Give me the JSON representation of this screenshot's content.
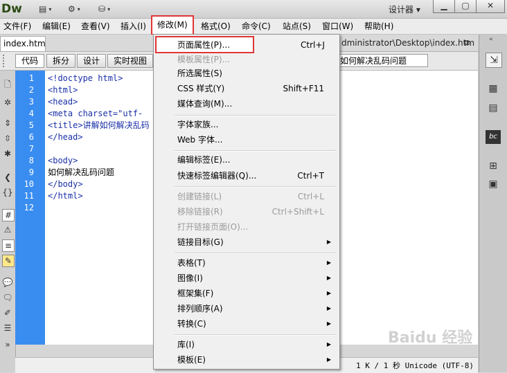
{
  "app": {
    "logo": "Dw",
    "workspace": "设计器 ▾"
  },
  "window_buttons": {
    "minimize": "▁",
    "maximize": "▢",
    "close": "✕"
  },
  "toolbar_icons": [
    "layout-icon",
    "gear-icon",
    "site-icon"
  ],
  "menubar": {
    "items": [
      "文件(F)",
      "编辑(E)",
      "查看(V)",
      "插入(I)",
      "修改(M)",
      "格式(O)",
      "命令(C)",
      "站点(S)",
      "窗口(W)",
      "帮助(H)"
    ]
  },
  "document": {
    "tab_name": "index.htm",
    "file_path": "dministrator\\Desktop\\index.htm",
    "title_field": "如何解决乱码问题"
  },
  "view_buttons": [
    "代码",
    "拆分",
    "设计",
    "实时视图"
  ],
  "code": {
    "line_numbers": [
      "1",
      "2",
      "3",
      "4",
      "5",
      "6",
      "7",
      "8",
      "9",
      "10",
      "11",
      "12"
    ],
    "lines": [
      "<!doctype html>",
      "<html>",
      "<head>",
      "<meta charset=\"utf-",
      "<title>讲解如何解决乱码",
      "</head>",
      "",
      "<body>",
      "如何解决乱码问题",
      "</body>",
      "</html>",
      ""
    ]
  },
  "status": {
    "text": "1 K / 1 秒 Unicode (UTF-8)"
  },
  "dropdown": {
    "items": [
      {
        "label": "页面属性(P)...",
        "shortcut": "Ctrl+J"
      },
      {
        "label": "模板属性(P)...",
        "shortcut": ""
      },
      {
        "label": "所选属性(S)",
        "shortcut": ""
      },
      {
        "label": "CSS 样式(Y)",
        "shortcut": "Shift+F11"
      },
      {
        "label": "媒体查询(M)...",
        "shortcut": ""
      },
      {
        "label": "字体家族...",
        "shortcut": ""
      },
      {
        "label": "Web 字体...",
        "shortcut": ""
      },
      {
        "label": "编辑标签(E)...",
        "shortcut": ""
      },
      {
        "label": "快速标签编辑器(Q)...",
        "shortcut": "Ctrl+T"
      },
      {
        "label": "创建链接(L)",
        "shortcut": "Ctrl+L"
      },
      {
        "label": "移除链接(R)",
        "shortcut": "Ctrl+Shift+L"
      },
      {
        "label": "打开链接页面(O)...",
        "shortcut": ""
      },
      {
        "label": "链接目标(G)",
        "shortcut": ""
      },
      {
        "label": "表格(T)",
        "shortcut": ""
      },
      {
        "label": "图像(I)",
        "shortcut": ""
      },
      {
        "label": "框架集(F)",
        "shortcut": ""
      },
      {
        "label": "排列顺序(A)",
        "shortcut": ""
      },
      {
        "label": "转换(C)",
        "shortcut": ""
      },
      {
        "label": "库(I)",
        "shortcut": ""
      },
      {
        "label": "模板(E)",
        "shortcut": ""
      }
    ]
  },
  "watermark": "Baidu 经验",
  "colors": {
    "highlight_red": "#e03535",
    "gutter_blue": "#3a8df0",
    "code_blue": "#1a2fa8"
  }
}
